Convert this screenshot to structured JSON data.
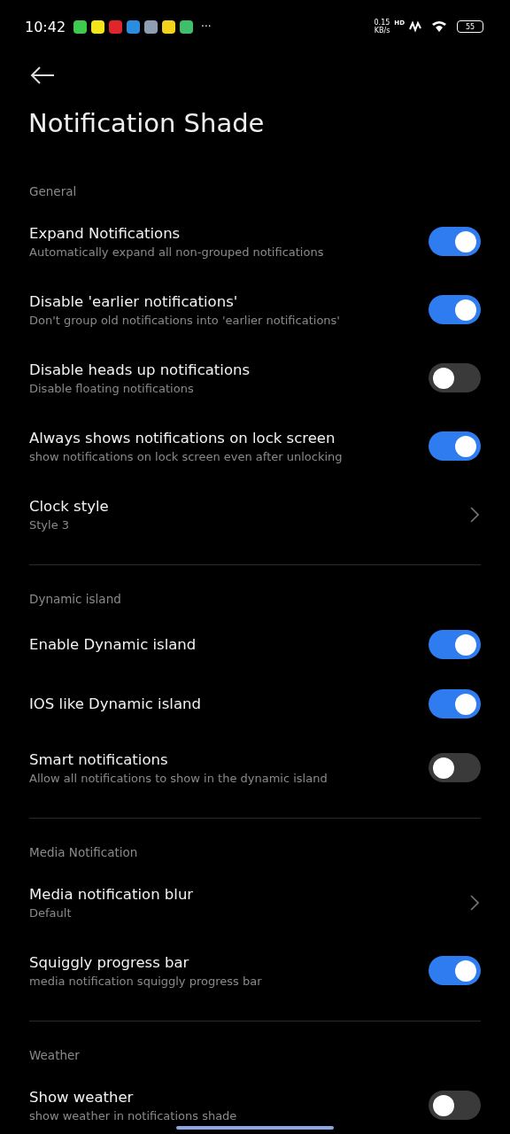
{
  "status_bar": {
    "time": "10:42",
    "app_icons": [
      {
        "color": "#3ec94f"
      },
      {
        "color": "#f2e51a"
      },
      {
        "color": "#e0262a"
      },
      {
        "color": "#2a8de0"
      },
      {
        "color": "#8f9db3"
      },
      {
        "color": "#f2d21a"
      },
      {
        "color": "#3fbf6a"
      }
    ],
    "more": "···",
    "net_speed": "0.15",
    "net_unit": "KB/s",
    "hd": "HD",
    "battery": "55"
  },
  "title": "Notification Shade",
  "sections": [
    {
      "header": "General",
      "items": [
        {
          "kind": "toggle",
          "title": "Expand Notifications",
          "subtitle": "Automatically expand all non-grouped notifications",
          "on": true
        },
        {
          "kind": "toggle",
          "title": "Disable 'earlier notifications'",
          "subtitle": "Don't group old notifications into 'earlier notifications'",
          "on": true
        },
        {
          "kind": "toggle",
          "title": "Disable heads up notifications",
          "subtitle": "Disable floating notifications",
          "on": false
        },
        {
          "kind": "toggle",
          "title": "Always shows notifications on lock screen",
          "subtitle": "show notifications on lock screen even after unlocking",
          "on": true
        },
        {
          "kind": "link",
          "title": "Clock style",
          "subtitle": "Style 3"
        }
      ]
    },
    {
      "header": "Dynamic island",
      "items": [
        {
          "kind": "toggle",
          "title": "Enable Dynamic island",
          "on": true
        },
        {
          "kind": "toggle",
          "title": "IOS like Dynamic island",
          "on": true
        },
        {
          "kind": "toggle",
          "title": "Smart notifications",
          "subtitle": "Allow all notifications to show in the dynamic island",
          "on": false
        }
      ]
    },
    {
      "header": "Media Notification",
      "items": [
        {
          "kind": "link",
          "title": "Media notification blur",
          "subtitle": "Default"
        },
        {
          "kind": "toggle",
          "title": "Squiggly progress bar",
          "subtitle": "media notification squiggly progress bar",
          "on": true
        }
      ]
    },
    {
      "header": "Weather",
      "items": [
        {
          "kind": "toggle",
          "title": "Show weather",
          "subtitle": "show weather in notifications shade",
          "on": false
        }
      ]
    }
  ]
}
